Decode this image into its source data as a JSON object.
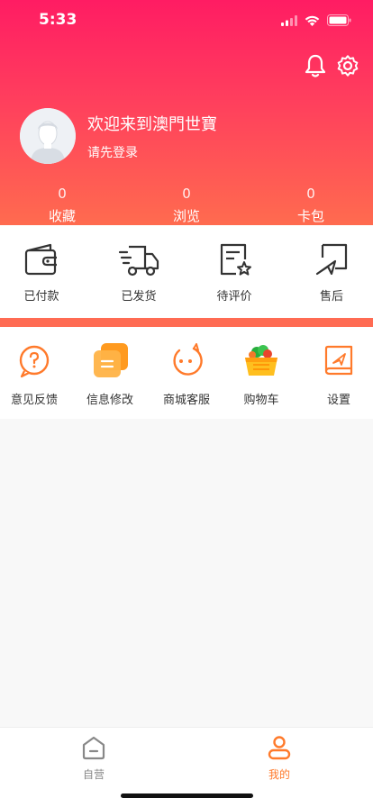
{
  "status_bar": {
    "time": "5:33"
  },
  "profile": {
    "welcome": "欢迎来到澳門世寶",
    "login_prompt": "请先登录"
  },
  "stats": [
    {
      "count": "0",
      "label": "收藏"
    },
    {
      "count": "0",
      "label": "浏览"
    },
    {
      "count": "0",
      "label": "卡包"
    }
  ],
  "orders": [
    {
      "label": "已付款",
      "icon": "wallet-icon"
    },
    {
      "label": "已发货",
      "icon": "truck-icon"
    },
    {
      "label": "待评价",
      "icon": "review-icon"
    },
    {
      "label": "售后",
      "icon": "after-sales-icon"
    }
  ],
  "services": [
    {
      "label": "意见反馈",
      "icon": "feedback-icon"
    },
    {
      "label": "信息修改",
      "icon": "edit-info-icon"
    },
    {
      "label": "商城客服",
      "icon": "customer-service-icon"
    },
    {
      "label": "购物车",
      "icon": "shopping-cart-icon"
    },
    {
      "label": "设置",
      "icon": "settings-book-icon"
    }
  ],
  "tabbar": [
    {
      "label": "自营",
      "icon": "home-icon"
    },
    {
      "label": "我的",
      "icon": "user-icon"
    }
  ],
  "colors": {
    "accent": "#ff6b2f",
    "header_top": "#ff1c63",
    "header_bottom": "#ff6b4f",
    "divider": "#ff6b53",
    "tab_active": "#ff7a2b",
    "tab_inactive": "#888888"
  }
}
